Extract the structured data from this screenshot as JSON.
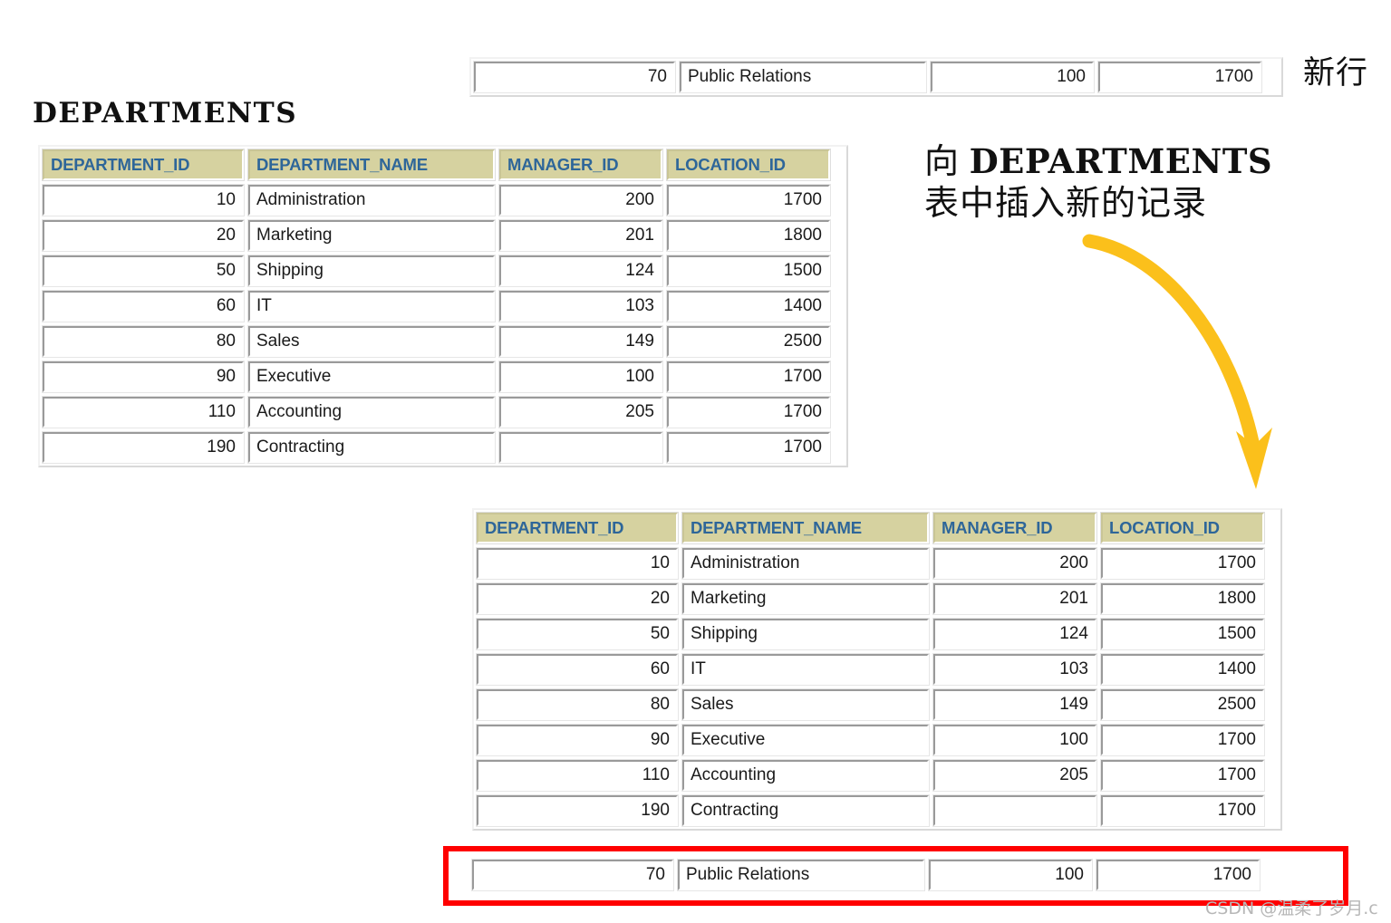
{
  "page": {
    "title": "DEPARTMENTS",
    "watermark": "CSDN @温柔了岁月.c"
  },
  "annotations": {
    "new_row_label": "新行",
    "insert_note_cjk_1": "向",
    "insert_note_latin": "DEPARTMENTS",
    "insert_note_cjk_2": "表中插入新的记录",
    "arrow_color": "#fbc01b",
    "highlight_color": "#ff0000"
  },
  "colors": {
    "header_background": "#d6d2a0",
    "header_text": "#2e6699",
    "cell_background": "#ffffff",
    "cell_border": "#9a9a9a",
    "page_background": "#ffffff"
  },
  "table": {
    "columns": [
      {
        "key": "department_id",
        "label": "DEPARTMENT_ID",
        "align": "num"
      },
      {
        "key": "department_name",
        "label": "DEPARTMENT_NAME",
        "align": "text"
      },
      {
        "key": "manager_id",
        "label": "MANAGER_ID",
        "align": "num"
      },
      {
        "key": "location_id",
        "label": "LOCATION_ID",
        "align": "num"
      }
    ],
    "rows": [
      {
        "department_id": "10",
        "department_name": "Administration",
        "manager_id": "200",
        "location_id": "1700"
      },
      {
        "department_id": "20",
        "department_name": "Marketing",
        "manager_id": "201",
        "location_id": "1800"
      },
      {
        "department_id": "50",
        "department_name": "Shipping",
        "manager_id": "124",
        "location_id": "1500"
      },
      {
        "department_id": "60",
        "department_name": "IT",
        "manager_id": "103",
        "location_id": "1400"
      },
      {
        "department_id": "80",
        "department_name": "Sales",
        "manager_id": "149",
        "location_id": "2500"
      },
      {
        "department_id": "90",
        "department_name": "Executive",
        "manager_id": "100",
        "location_id": "1700"
      },
      {
        "department_id": "110",
        "department_name": "Accounting",
        "manager_id": "205",
        "location_id": "1700"
      },
      {
        "department_id": "190",
        "department_name": "Contracting",
        "manager_id": "",
        "location_id": "1700"
      }
    ],
    "new_row": {
      "department_id": "70",
      "department_name": "Public Relations",
      "manager_id": "100",
      "location_id": "1700"
    }
  }
}
